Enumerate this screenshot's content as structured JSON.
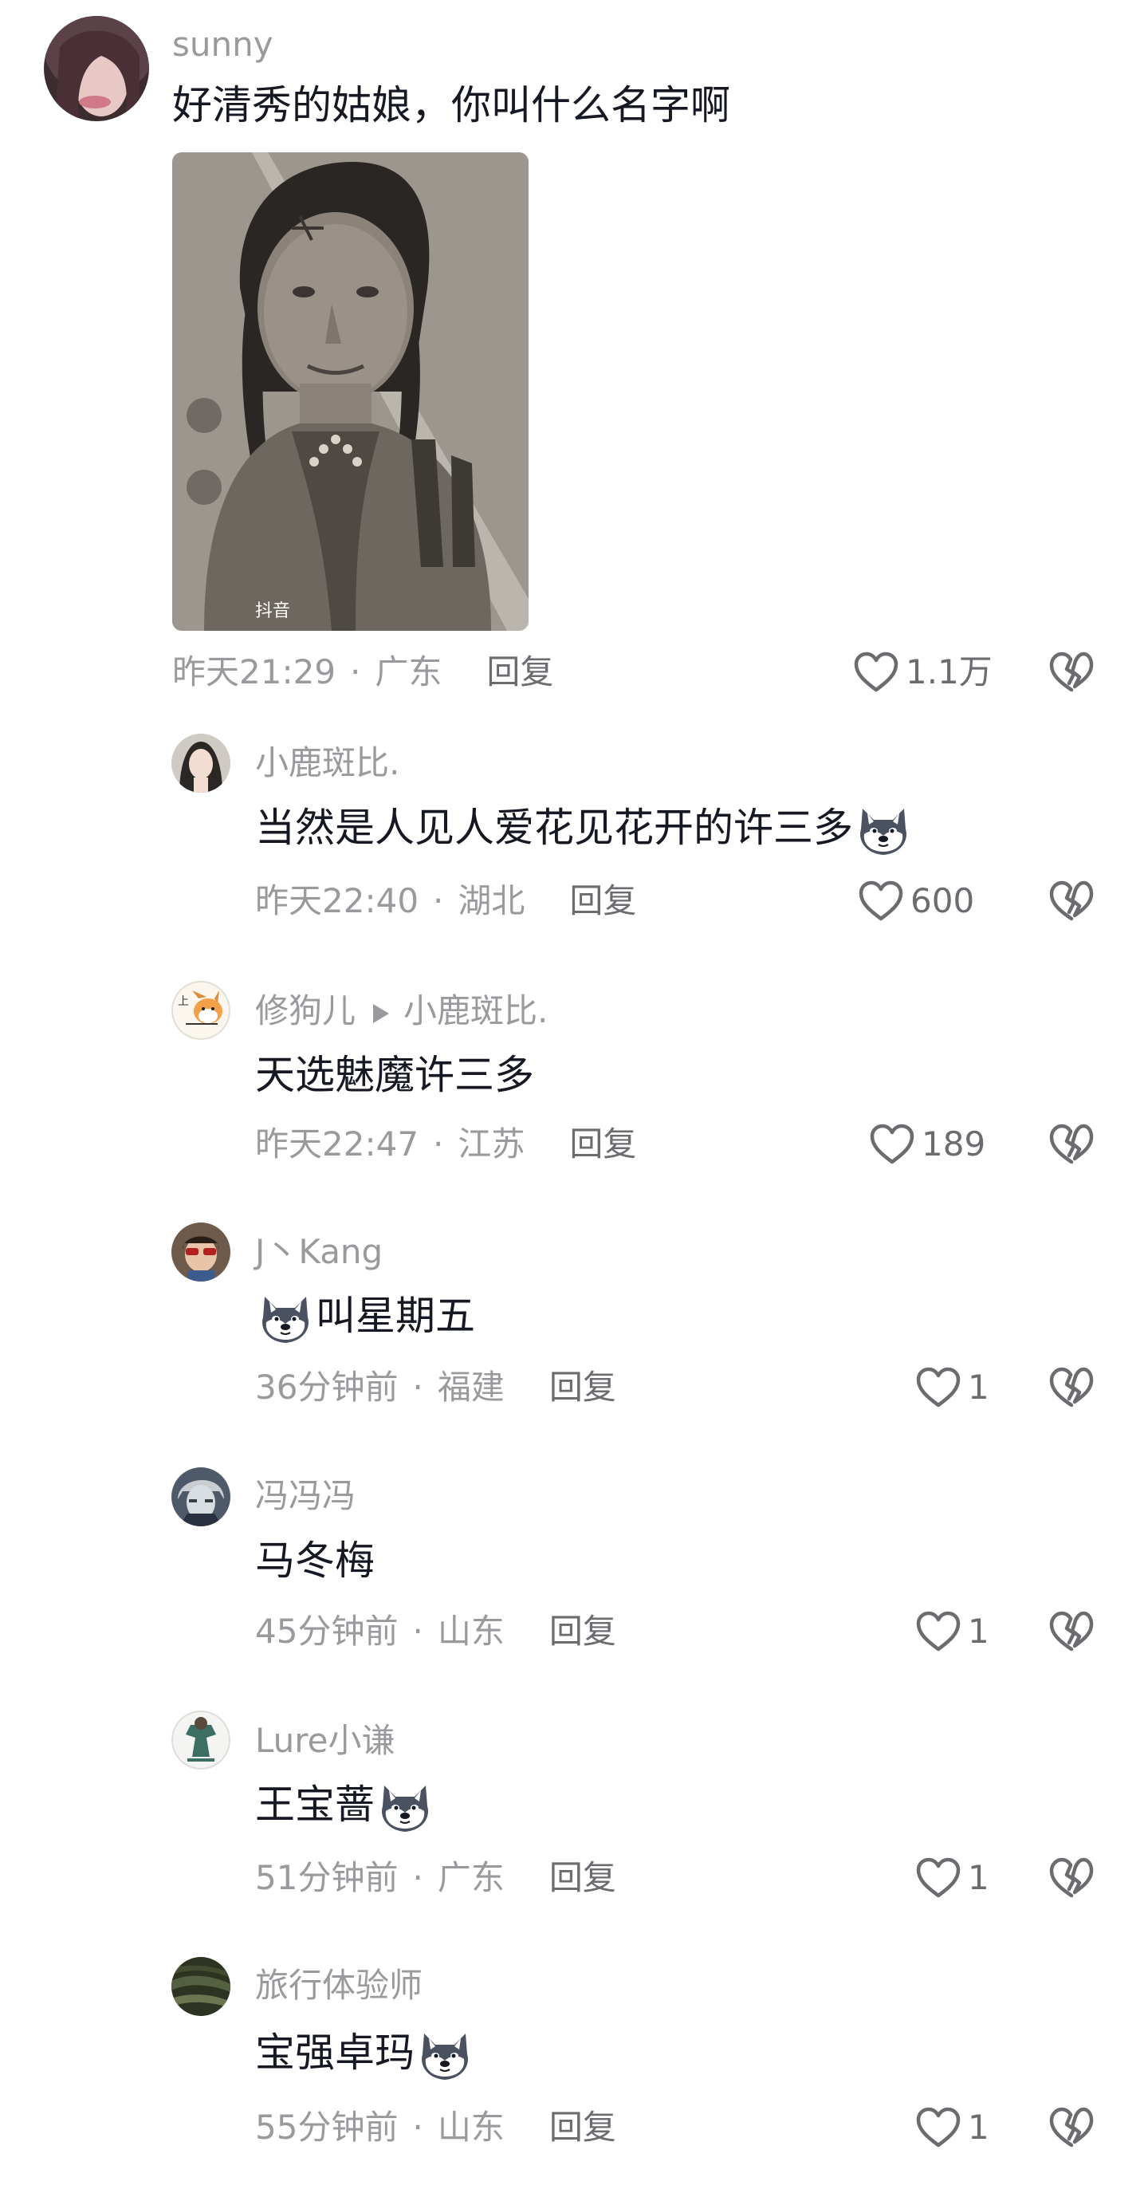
{
  "main_comment": {
    "username": "sunny",
    "text": "好清秀的姑娘，你叫什么名字啊",
    "time": "昨天21:29",
    "location": "广东",
    "reply": "回复",
    "likes": "1.1万",
    "image_watermark": "抖音"
  },
  "replies": [
    {
      "username": "小鹿斑比.",
      "text": "当然是人见人爱花见花开的许三多",
      "emoji": "wolf-emoji",
      "time": "昨天22:40",
      "location": "湖北",
      "reply": "回复",
      "likes": "600"
    },
    {
      "username": "修狗儿",
      "reply_to": "小鹿斑比.",
      "text": "天选魅魔许三多",
      "time": "昨天22:47",
      "location": "江苏",
      "reply": "回复",
      "likes": "189"
    },
    {
      "username": "J丶Kang",
      "text": "叫星期五",
      "emoji": "wolf-emoji",
      "time": "36分钟前",
      "location": "福建",
      "reply": "回复",
      "likes": "1"
    },
    {
      "username": "冯冯冯",
      "text": "马冬梅",
      "time": "45分钟前",
      "location": "山东",
      "reply": "回复",
      "likes": "1"
    },
    {
      "username": "Lure小谦",
      "text": "王宝蔷",
      "emoji": "wolf-emoji",
      "time": "51分钟前",
      "location": "广东",
      "reply": "回复",
      "likes": "1"
    },
    {
      "username": "旅行体验师",
      "text": "宝强卓玛",
      "emoji": "wolf-emoji",
      "time": "55分钟前",
      "location": "山东",
      "reply": "回复",
      "likes": "1"
    }
  ],
  "separator": "·",
  "icons": {
    "like": "heart-outline-icon",
    "dislike": "broken-heart-icon"
  },
  "colors": {
    "text": "#161823",
    "secondary": "#9a9a9e",
    "action": "#6b6b70",
    "background": "#ffffff"
  }
}
